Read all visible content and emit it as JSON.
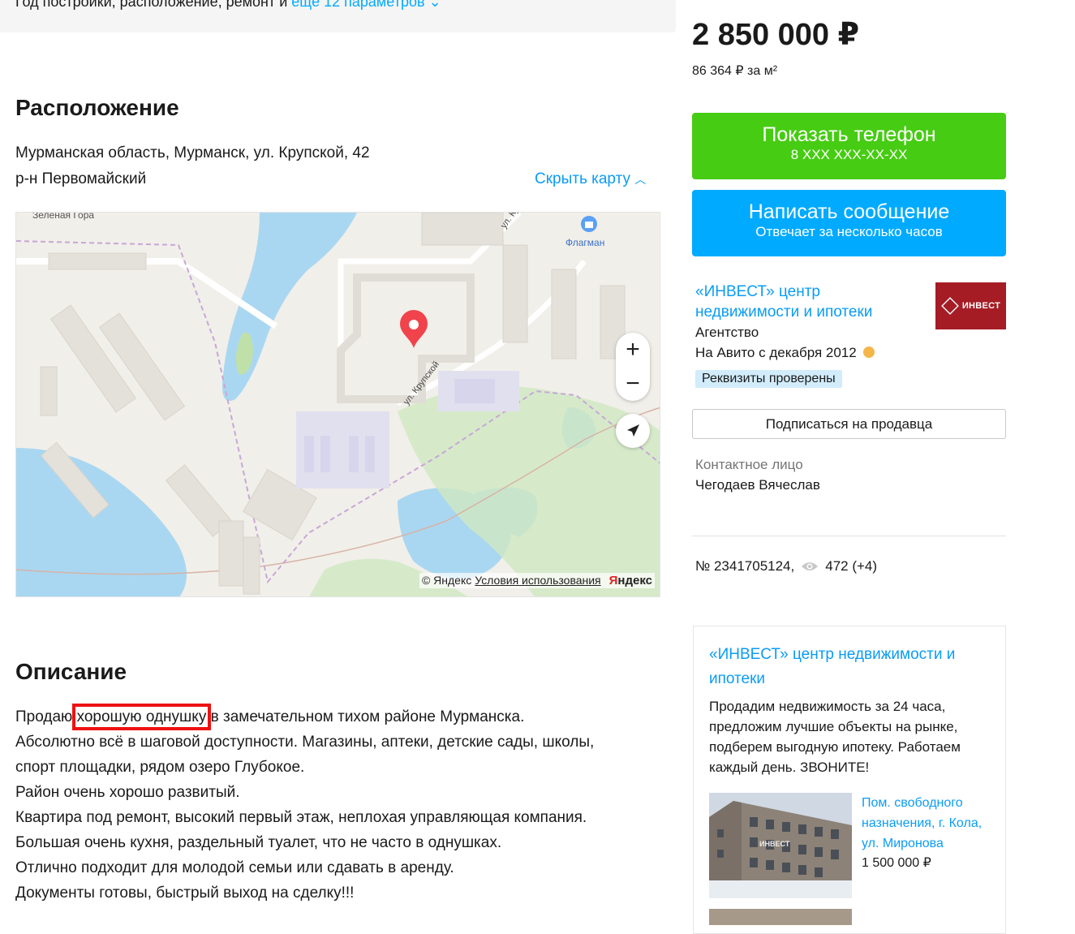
{
  "params": {
    "text": "Год постройки, расположение, ремонт и",
    "more_link": "ещё 12 параметров"
  },
  "location": {
    "title": "Расположение",
    "address": "Мурманская область, Мурманск, ул. Крупской, 42",
    "district": "р-н Первомайский",
    "hide_map": "Скрыть карту"
  },
  "map": {
    "labels": {
      "area": "Зелёная Гора",
      "poi": "Флагман",
      "street_top": "ул. Крупской",
      "street": "ул. Крупской"
    },
    "zoom_in": "+",
    "zoom_out": "−",
    "copyright": "© Яндекс",
    "terms": "Условия использования",
    "logo_red": "Я",
    "logo_black": "ндекс"
  },
  "description": {
    "title": "Описание",
    "line1_before": "Продаю ",
    "line1_highlight": "хорошую однушку",
    "line1_after": " в замечательном тихом районе Мурманска.",
    "lines": [
      "Абсолютно всё в шаговой доступности. Магазины, аптеки, детские сады, школы,",
      "спорт площадки, рядом озеро Глубокое.",
      "Район очень хорошо развитый.",
      "Квартира под ремонт, высокий первый этаж, неплохая управляющая компания.",
      "Большая очень кухня, раздельный туалет, что не часто в однушках.",
      "Отлично подходит для молодой семьи или сдавать в аренду.",
      "Документы готовы, быстрый выход на сделку!!!"
    ]
  },
  "sidebar": {
    "price": "2 850 000 ₽",
    "price_per_m2": "86 364 ₽ за м²",
    "phone_button": {
      "label": "Показать телефон",
      "sub": "8 XXX XXX-XX-XX"
    },
    "message_button": {
      "label": "Написать сообщение",
      "sub": "Отвечает за несколько часов"
    },
    "seller": {
      "name": "«ИНВЕСТ» центр недвижимости и ипотеки",
      "type": "Агентство",
      "since": "На Авито с декабря 2012",
      "badge": "Реквизиты проверены",
      "logo_text": "ИНВЕСТ"
    },
    "subscribe_button": "Подписаться на продавца",
    "contact_label": "Контактное лицо",
    "contact_name": "Чегодаев Вячеслав",
    "ad_number": "№ 2341705124,",
    "views": "472 (+4)"
  },
  "promo": {
    "title": "«ИНВЕСТ» центр недвижимости и ипотеки",
    "text": "Продадим недвижимость за 24 часа, предложим лучшие объекты на рынке, подберем выгодную ипотеку. Работаем каждый день. ЗВОНИТЕ!",
    "listing_title": "Пом. свободного назначения, г. Кола, ул. Миронова",
    "listing_price": "1 500 000 ₽",
    "thumb_watermark": "ИНВЕСТ"
  },
  "colors": {
    "link": "#0a9cf5",
    "phone_button": "#46cc12",
    "message_button": "#00aaff",
    "highlight_box": "#ee1111",
    "seller_logo": "#a51c25"
  }
}
